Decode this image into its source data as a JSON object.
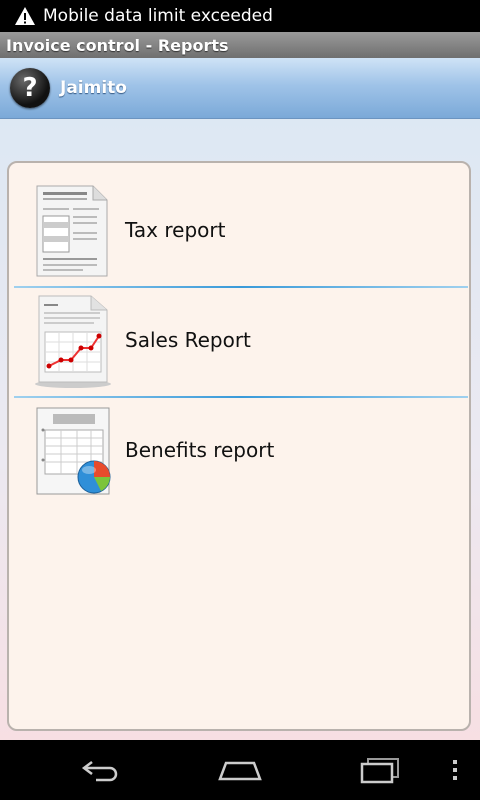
{
  "status_bar": {
    "message": "Mobile data limit exceeded"
  },
  "title_bar": {
    "title": "Invoice control - Reports"
  },
  "user": {
    "name": "Jaimito",
    "help_symbol": "?"
  },
  "reports": [
    {
      "label": "Tax report",
      "icon": "tax-report-icon"
    },
    {
      "label": "Sales Report",
      "icon": "sales-report-icon"
    },
    {
      "label": "Benefits report",
      "icon": "benefits-report-icon"
    }
  ],
  "nav": {
    "buttons": [
      "back-icon",
      "home-icon",
      "recent-apps-icon",
      "overflow-menu-icon"
    ]
  },
  "colors": {
    "accent": "#3a9ad9",
    "header": "#7ba9d8",
    "panel": "#fdf3ec"
  }
}
